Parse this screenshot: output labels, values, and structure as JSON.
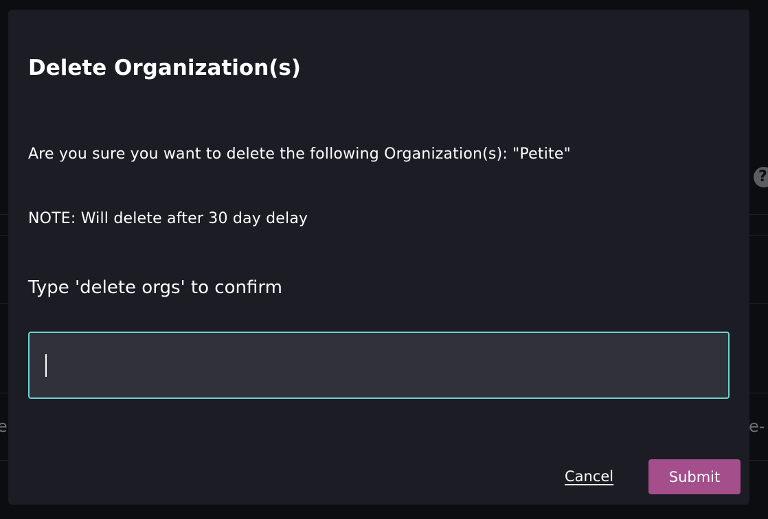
{
  "background": {
    "help_symbol": "?",
    "left_fragment": "e",
    "right_fragment": "e-"
  },
  "dialog": {
    "title": "Delete Organization(s)",
    "question": "Are you sure you want to delete the following Organization(s): \"Petite\"",
    "note": "NOTE: Will delete after 30 day delay",
    "confirm_label": "Type 'delete orgs' to confirm",
    "confirm_input": {
      "value": "",
      "placeholder": ""
    },
    "cancel_label": "Cancel",
    "submit_label": "Submit"
  },
  "colors": {
    "modal_bg": "#1b1c24",
    "input_bg": "#30313b",
    "input_border": "#6dd3cd",
    "submit_bg": "#a44e8c"
  }
}
